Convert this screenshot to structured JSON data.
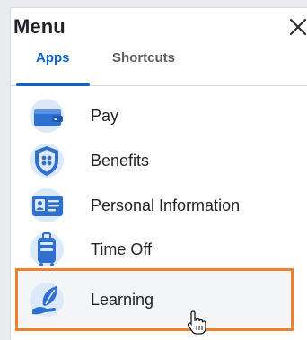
{
  "menu": {
    "title": "Menu",
    "close_icon": "close-icon"
  },
  "tabs": [
    {
      "label": "Apps",
      "active": true
    },
    {
      "label": "Shortcuts",
      "active": false
    }
  ],
  "apps": [
    {
      "label": "Pay",
      "icon": "wallet-icon"
    },
    {
      "label": "Benefits",
      "icon": "shield-icon"
    },
    {
      "label": "Personal Information",
      "icon": "id-card-icon"
    },
    {
      "label": "Time Off",
      "icon": "suitcase-icon"
    },
    {
      "label": "Learning",
      "icon": "hand-leaf-icon",
      "highlighted": true
    }
  ],
  "colors": {
    "accent": "#0b63c9",
    "highlight_border": "#f0802c",
    "icon_blue": "#2f6fcf",
    "icon_circle": "#dce9fb"
  }
}
